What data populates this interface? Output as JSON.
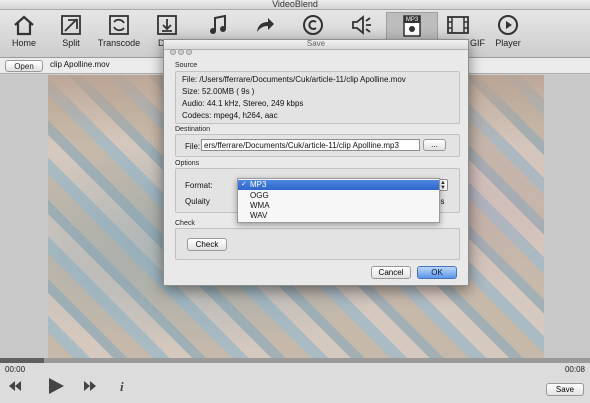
{
  "app": {
    "title": "VideoBlend"
  },
  "toolbar": {
    "items": [
      {
        "label": "Home",
        "icon": "home-icon"
      },
      {
        "label": "Split",
        "icon": "split-icon"
      },
      {
        "label": "Transcode",
        "icon": "transcode-icon"
      },
      {
        "label": "Dow",
        "icon": "download-icon"
      },
      {
        "label": "",
        "icon": "music-icon"
      },
      {
        "label": "",
        "icon": "share-icon"
      },
      {
        "label": "",
        "icon": "copyright-icon"
      },
      {
        "label": "",
        "icon": "audio-icon"
      },
      {
        "label": "",
        "icon": "mp3-icon",
        "badge": "MP3"
      },
      {
        "label": "GIF",
        "icon": "film-icon"
      },
      {
        "label": "Player",
        "icon": "player-icon"
      }
    ]
  },
  "pathbar": {
    "open_label": "Open",
    "filename": "clip Apolline.mov"
  },
  "playback": {
    "time_start": "00:00",
    "time_end": "00:08",
    "save_label": "Save",
    "progress": 0.075
  },
  "dialog": {
    "title": "Save",
    "source": {
      "section": "Source",
      "file": "File: /Users/fferrare/Documents/Cuk/article-11/clip Apolline.mov",
      "size": "Size: 52.00MB ( 9s )",
      "audio": "Audio: 44.1 kHz, Stereo, 249 kbps",
      "codecs": "Codecs: mpeg4, h264, aac"
    },
    "destination": {
      "section": "Destination",
      "file_label": "File:",
      "path": "ers/fferrare/Documents/Cuk/article-11/clip Apolline.mp3",
      "browse_label": "..."
    },
    "options": {
      "section": "Options",
      "format_label": "Format:",
      "quality_label": "Qulaity",
      "quality_suffix": "ps",
      "formats": [
        "MP3",
        "OGG",
        "WMA",
        "WAV"
      ],
      "selected_format": "MP3"
    },
    "check": {
      "section": "Check",
      "button_label": "Check"
    },
    "cancel_label": "Cancel",
    "ok_label": "OK"
  },
  "colors": {
    "selection": "#3a72d6",
    "ok_button": "#6aa3ee"
  }
}
